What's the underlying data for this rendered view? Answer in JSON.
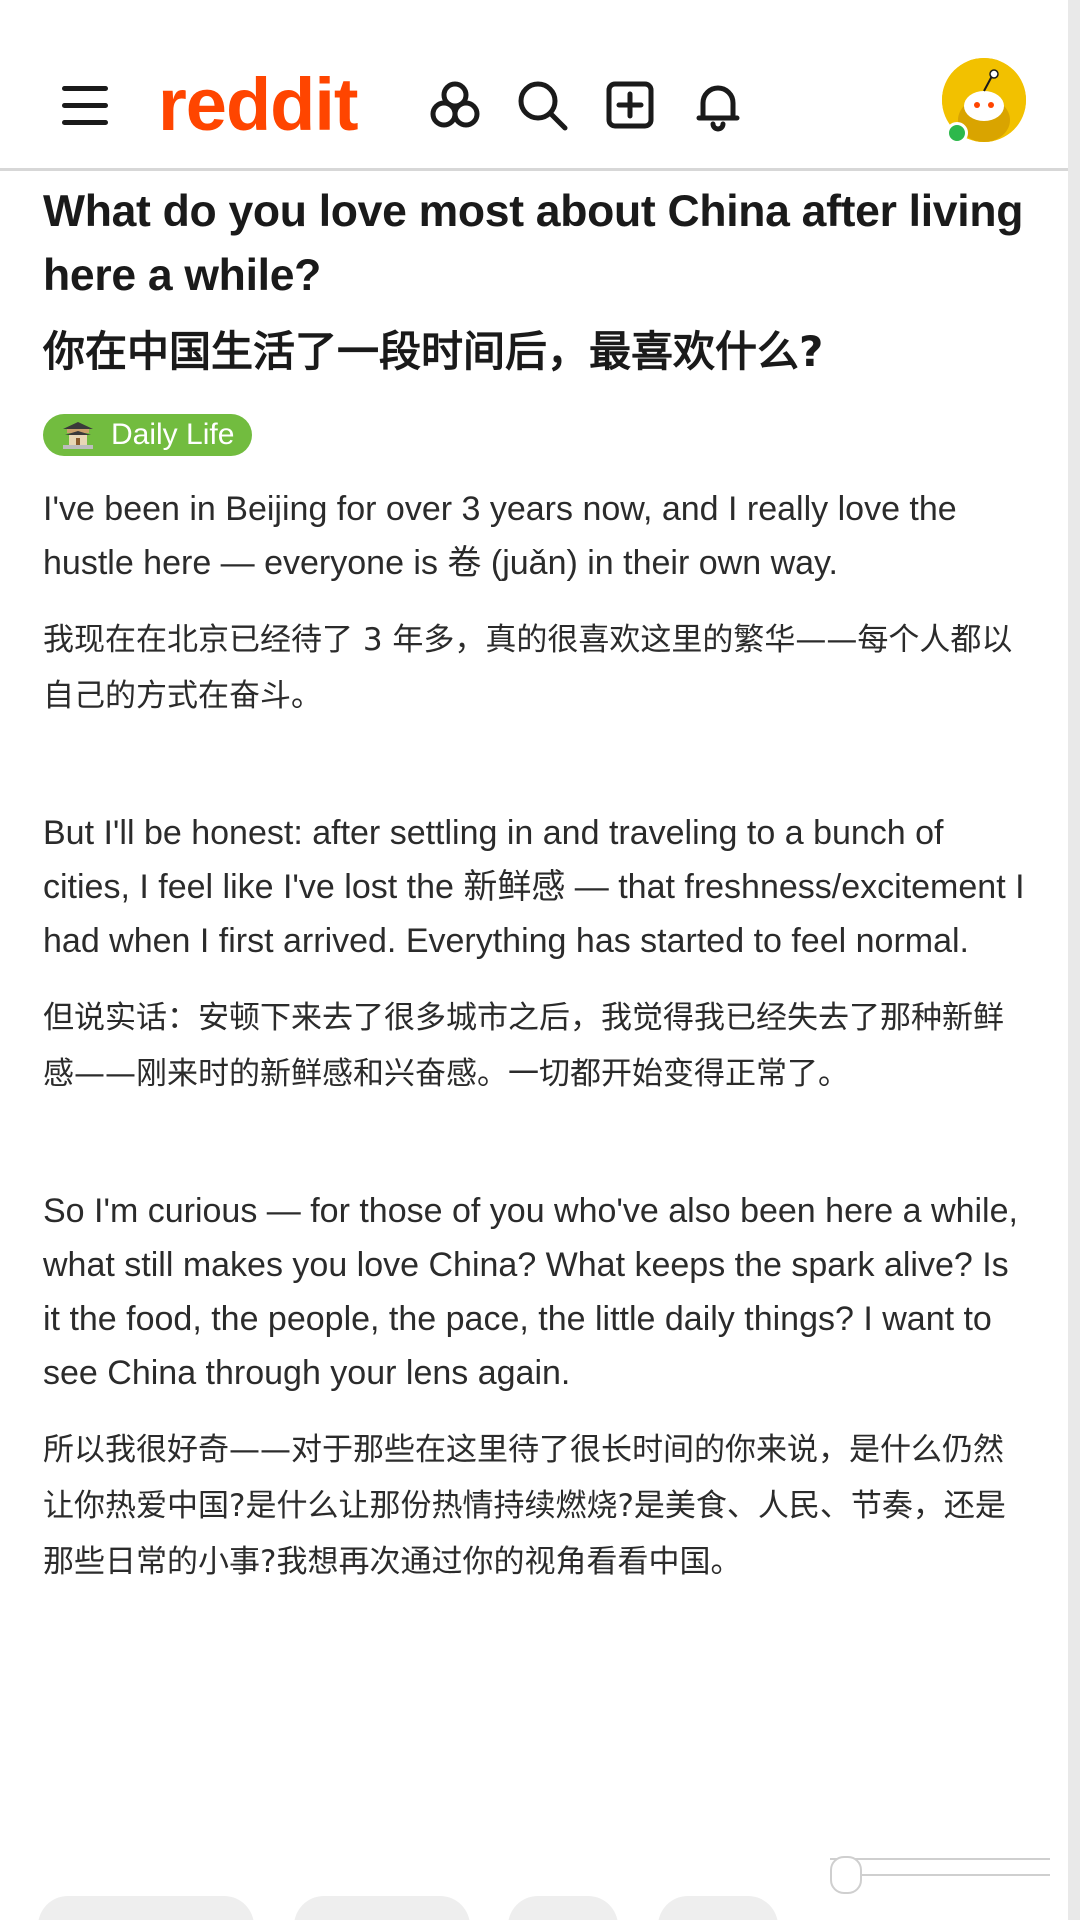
{
  "header": {
    "logo_text": "reddit",
    "logo_color": "#ff4500",
    "icons": [
      "menu-icon",
      "explore-icon",
      "search-icon",
      "create-post-icon",
      "notifications-icon",
      "avatar"
    ]
  },
  "post": {
    "title_en": "What do you love most about China after living here a while?",
    "title_zh": "你在中国生活了一段时间后，最喜欢什么?",
    "flair": {
      "label": "Daily Life",
      "color": "#72bc3f",
      "icon": "temple-icon"
    },
    "paragraphs": [
      {
        "en": "I've been in Beijing for over 3 years now, and I really love the hustle here — everyone is 卷 (juǎn) in their own way.",
        "zh": "我现在在北京已经待了 3 年多，真的很喜欢这里的繁华——每个人都以自己的方式在奋斗。"
      },
      {
        "en": "But I'll be honest: after settling in and traveling to a bunch of cities, I feel like I've lost the 新鲜感 — that freshness/excitement I had when I first arrived. Everything has started to feel normal.",
        "zh": "但说实话：安顿下来去了很多城市之后，我觉得我已经失去了那种新鲜感——刚来时的新鲜感和兴奋感。一切都开始变得正常了。"
      },
      {
        "en": "So I'm curious — for those of you who've also been here a while, what still makes you love China? What keeps the spark alive? Is it the food, the people, the pace, the little daily things? I want to see China through your lens again.",
        "zh": "所以我很好奇——对于那些在这里待了很长时间的你来说，是什么仍然让你热爱中国?是什么让那份热情持续燃烧?是美食、人民、节奏，还是那些日常的小事?我想再次通过你的视角看看中国。"
      }
    ]
  }
}
